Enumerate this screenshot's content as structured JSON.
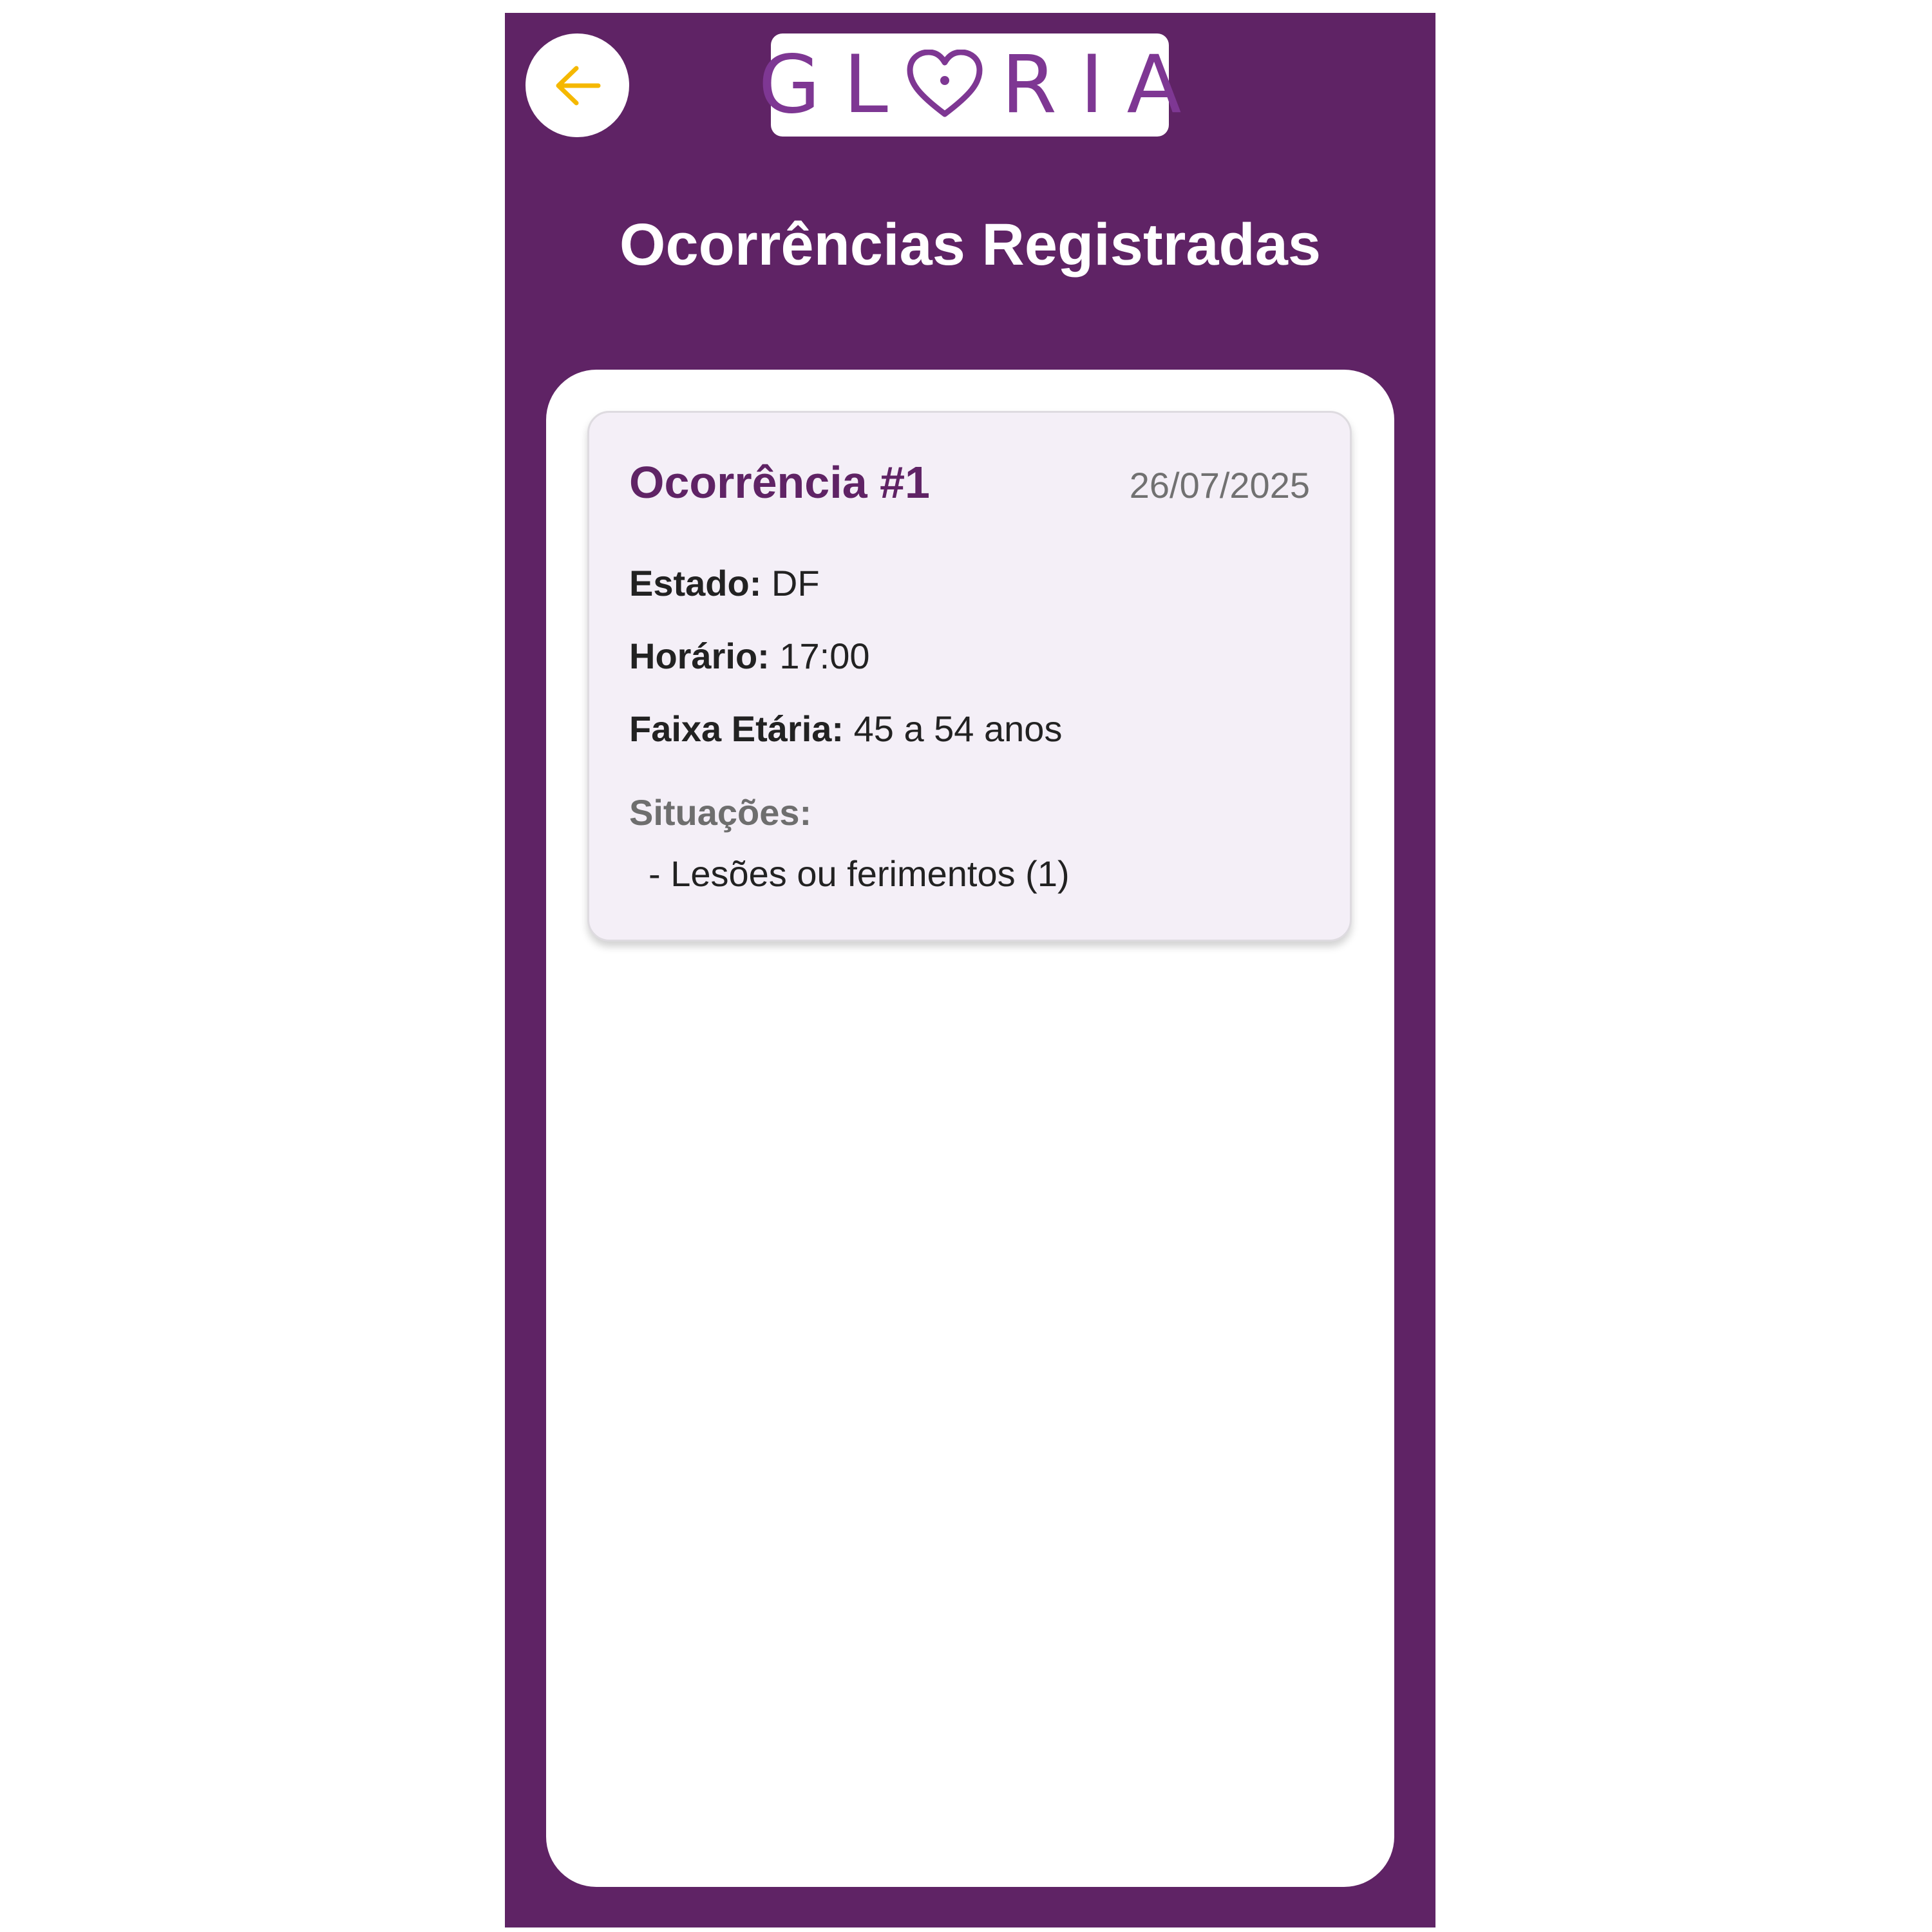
{
  "colors": {
    "primary": "#5f2365",
    "logo": "#7e3793",
    "back_arrow": "#f5b800",
    "card_background": "#f4eff7"
  },
  "header": {
    "back_icon": "arrow-left-icon",
    "logo_text": "GLORIA",
    "title": "Ocorrências Registradas"
  },
  "occurrences": [
    {
      "title": "Ocorrência #1",
      "date": "26/07/2025",
      "estado_label": "Estado:",
      "estado_value": "DF",
      "horario_label": "Horário:",
      "horario_value": "17:00",
      "faixa_label": "Faixa Etária:",
      "faixa_value": "45 a 54 anos",
      "situacoes_label": "Situações:",
      "situacoes": [
        "- Lesões ou ferimentos (1)"
      ]
    }
  ]
}
